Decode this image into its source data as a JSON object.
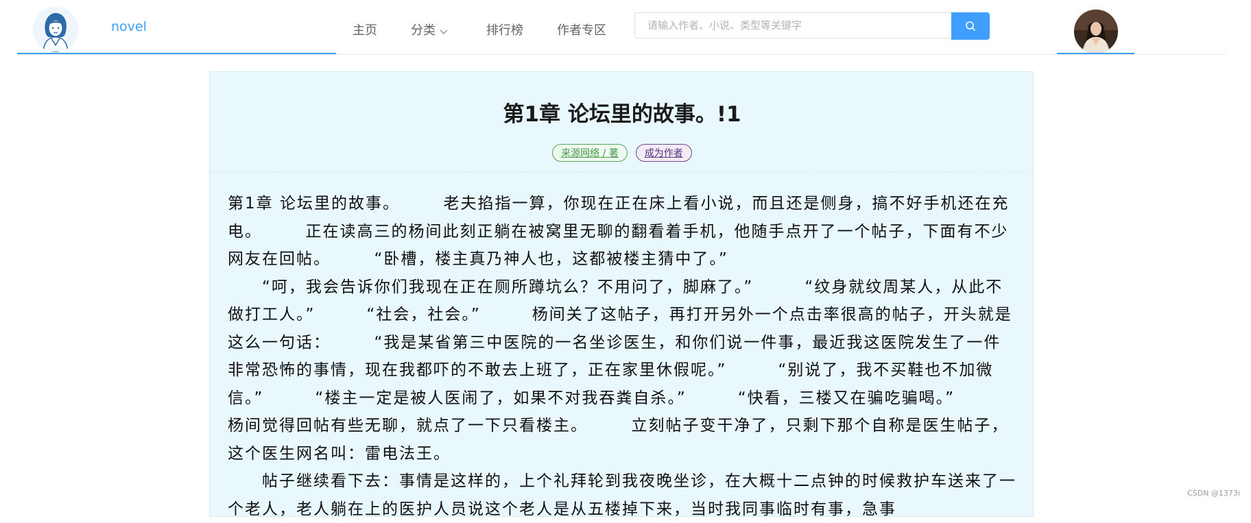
{
  "header": {
    "brand": "novel",
    "logo_icon": "girl-avatar-logo-icon",
    "nav": [
      {
        "label": "主页"
      },
      {
        "label": "分类"
      },
      {
        "label": "排行榜"
      },
      {
        "label": "作者专区"
      }
    ],
    "search": {
      "placeholder": "请输入作者、小说、类型等关键字",
      "value": "",
      "icon": "search-icon"
    },
    "user_avatar_icon": "user-avatar",
    "accent_color": "#409eff"
  },
  "chapter": {
    "title": "第1章 论坛里的故事。!1",
    "tags": [
      {
        "label": "来源网络 / 著",
        "color": "#4a9a4a"
      },
      {
        "label": "成为作者",
        "color": "#5b2f7c"
      }
    ],
    "content": "第1章 论坛里的故事。　　　老夫掐指一算，你现在正在床上看小说，而且还是侧身，搞不好手机还在充电。　　　正在读高三的杨间此刻正躺在被窝里无聊的翻看着手机，他随手点开了一个帖子，下面有不少网友在回帖。　　　“卧槽，楼主真乃神人也，这都被楼主猜中了。”\n　　“呵，我会告诉你们我现在正在厕所蹲坑么？不用问了，脚麻了。”　　　“纹身就纹周某人，从此不做打工人。”　　　“社会，社会。”　　　杨间关了这帖子，再打开另外一个点击率很高的帖子，开头就是这么一句话：　　　“我是某省第三中医院的一名坐诊医生，和你们说一件事，最近我这医院发生了一件非常恐怖的事情，现在我都吓的不敢去上班了，正在家里休假呢。”　　　“别说了，我不买鞋也不加微信。”　　　“楼主一定是被人医闹了，如果不对我吞粪自杀。”　　　“快看，三楼又在骗吃骗喝。”　　　杨间觉得回帖有些无聊，就点了一下只看楼主。　　　立刻帖子变干净了，只剩下那个自称是医生帖子，这个医生网名叫：雷电法王。\n　　帖子继续看下去：事情是这样的，上个礼拜轮到我夜晚坐诊，在大概十二点钟的时候救护车送来了一个老人，老人躺在上的医护人员说这个老人是从五楼掉下来，当时我同事临时有事，急事"
  },
  "watermark": "CSDN @1373i"
}
